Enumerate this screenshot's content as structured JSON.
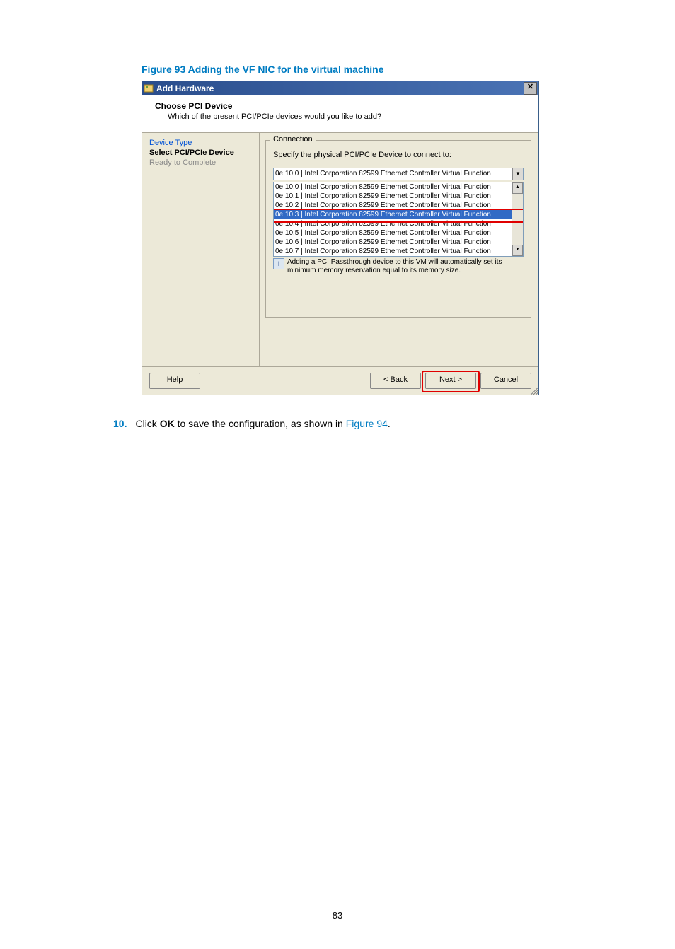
{
  "figure_caption": "Figure 93 Adding the VF NIC for the virtual machine",
  "window": {
    "title": "Add Hardware",
    "header_title": "Choose PCI Device",
    "header_sub": "Which of the present PCI/PCIe devices would you like to add?",
    "sidebar": {
      "device_type": "Device Type",
      "select_pci": "Select PCI/PCIe Device",
      "ready": "Ready to Complete"
    },
    "connection": {
      "legend": "Connection",
      "instruction": "Specify the physical PCI/PCIe Device to connect to:",
      "selected": "0e:10.0 |  Intel Corporation 82599 Ethernet Controller Virtual Function",
      "options": [
        "0e:10.0 |  Intel Corporation 82599 Ethernet Controller Virtual Function",
        "0e:10.1 |  Intel Corporation 82599 Ethernet Controller Virtual Function",
        "0e:10.2 |  Intel Corporation 82599 Ethernet Controller Virtual Function",
        "0e:10.3 |  Intel Corporation 82599 Ethernet Controller Virtual Function",
        "0e:10.4 |  Intel Corporation 82599 Ethernet Controller Virtual Function",
        "0e:10.5 |  Intel Corporation 82599 Ethernet Controller Virtual Function",
        "0e:10.6 |  Intel Corporation 82599 Ethernet Controller Virtual Function",
        "0e:10.7 |  Intel Corporation 82599 Ethernet Controller Virtual Function"
      ],
      "info": "Adding a PCI Passthrough device to this VM will automatically set its minimum memory reservation equal to its memory size."
    },
    "buttons": {
      "help": "Help",
      "back": "< Back",
      "next": "Next >",
      "cancel": "Cancel"
    }
  },
  "step": {
    "number": "10.",
    "prefix": "Click ",
    "bold": "OK",
    "mid": " to save the configuration, as shown in ",
    "link": "Figure 94",
    "suffix": "."
  },
  "page_number": "83"
}
